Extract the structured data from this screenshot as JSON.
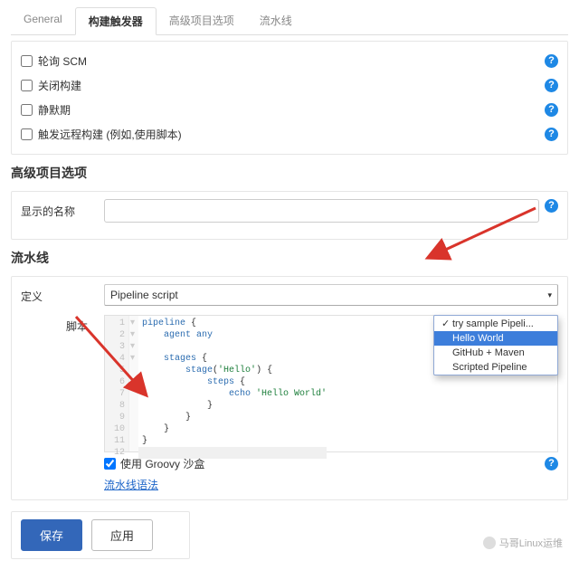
{
  "tabs": {
    "general": "General",
    "triggers": "构建触发器",
    "advanced": "高级项目选项",
    "pipeline": "流水线"
  },
  "triggers": {
    "poll_scm": "轮询 SCM",
    "disable_build": "关闭构建",
    "quiet_period": "静默期",
    "remote_trigger": "触发远程构建 (例如,使用脚本)"
  },
  "advanced": {
    "title": "高级项目选项",
    "display_name_label": "显示的名称",
    "display_name_value": ""
  },
  "pipeline": {
    "title": "流水线",
    "definition_label": "定义",
    "definition_value": "Pipeline script",
    "script_label": "脚本",
    "sandbox_label": "使用 Groovy 沙盒",
    "sandbox_checked": true,
    "syntax_link": "流水线语法"
  },
  "sample_dropdown": {
    "items": [
      {
        "label": "try sample Pipeli...",
        "checked": true,
        "selected": false
      },
      {
        "label": "Hello World",
        "checked": false,
        "selected": true
      },
      {
        "label": "GitHub + Maven",
        "checked": false,
        "selected": false
      },
      {
        "label": "Scripted Pipeline",
        "checked": false,
        "selected": false
      }
    ]
  },
  "code": {
    "lines": [
      "pipeline {",
      "    agent any",
      "",
      "    stages {",
      "        stage('Hello') {",
      "            steps {",
      "                echo 'Hello World'",
      "            }",
      "        }",
      "    }",
      "}",
      ""
    ]
  },
  "buttons": {
    "save": "保存",
    "apply": "应用"
  },
  "watermark": "马哥Linux运维",
  "help_glyph": "?"
}
